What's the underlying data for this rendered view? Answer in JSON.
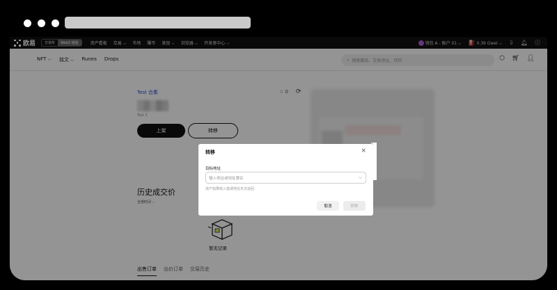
{
  "top_nav": {
    "logo_text": "欧易",
    "mode_switch": [
      "交易所",
      "Web3 钱包"
    ],
    "links": [
      "资产看板",
      "交易 ⌵",
      "市场",
      "赚币",
      "发现 ⌵",
      "浏览器 ⌵",
      "开发者中心 ⌵"
    ],
    "wallet": "钱包 A - 账户 01 ⌵",
    "gas": "0.39 Gwei ⌵"
  },
  "sub_nav": {
    "links": [
      "NFT ⌵",
      "铭文 ⌵",
      "Runes",
      "Drops"
    ],
    "search_placeholder": "搜索藏品、交易地址、项目"
  },
  "item": {
    "collection": "Test 合集",
    "likes": "0",
    "name": "Test 3",
    "list_label": "上架",
    "transfer_label": "转移"
  },
  "history": {
    "title": "历史成交价",
    "time_filter": "全部时间 ⌵",
    "empty_text": "暂无记录"
  },
  "tabs": [
    {
      "label": "出售订单",
      "active": true
    },
    {
      "label": "出价订单",
      "active": false
    },
    {
      "label": "交易历史",
      "active": false
    }
  ],
  "modal": {
    "title": "转移",
    "field_label": "目标地址",
    "input_placeholder": "输入地址或地址簿名",
    "hint": "资产如果转入错误地址无法追回",
    "cancel_label": "取消",
    "confirm_label": "转移"
  },
  "colors": {
    "accent_link": "#2b4fd6",
    "primary": "#111111"
  }
}
